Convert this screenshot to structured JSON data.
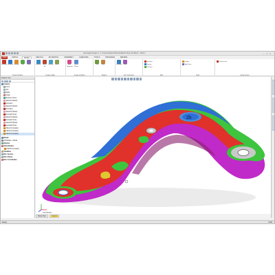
{
  "window": {
    "title": "Geomagic Design X - [ C:\\Users\\Admin\\Downloads\\01 Xbar.xdt (Mesh - Xbar) ]"
  },
  "ribbon_tabs": [
    {
      "label": "FILE"
    },
    {
      "label": "INITIAL"
    },
    {
      "label": "BASIC"
    },
    {
      "label": "SKETCH"
    },
    {
      "label": "3D SKETCH"
    },
    {
      "label": "ASSEMBLY"
    },
    {
      "label": "CHECKING"
    },
    {
      "label": "TOOLS"
    },
    {
      "label": "PROGRAM"
    },
    {
      "label": "REVIEW"
    }
  ],
  "ribbon_groups": [
    {
      "label": "Create Surface"
    },
    {
      "label": "Create & Edit"
    },
    {
      "label": "Create & Match"
    },
    {
      "label": "Region"
    },
    {
      "label": "Ref. Geometry"
    },
    {
      "label": "Edit"
    },
    {
      "label": "Tools"
    },
    {
      "label": "Assign Fixes"
    }
  ],
  "ribbon_buttons": [
    {
      "label": "Extrude"
    },
    {
      "label": "Revolve"
    },
    {
      "label": "Sweep"
    },
    {
      "label": "Loft"
    },
    {
      "label": "Offset"
    },
    {
      "label": "Extract"
    },
    {
      "label": "Mesh Fit"
    },
    {
      "label": "Surface"
    },
    {
      "label": "Mesh"
    },
    {
      "label": "Auto Segment"
    },
    {
      "label": "Insert Plane"
    },
    {
      "label": "Trim"
    },
    {
      "label": "Fillet"
    },
    {
      "label": "Chamfer"
    },
    {
      "label": "Shell"
    }
  ],
  "ribbon_small": [
    {
      "label": "Sections"
    },
    {
      "label": "Sweep"
    },
    {
      "label": "Fill Face"
    },
    {
      "label": "Untrim"
    },
    {
      "label": "Split Face"
    },
    {
      "label": "Delete Face"
    }
  ],
  "left_panel": {
    "title": "Feature Tree",
    "tree": [
      {
        "label": "Feature"
      },
      {
        "label": "Front"
      },
      {
        "label": "Top"
      },
      {
        "label": "Right"
      },
      {
        "label": "Origin"
      },
      {
        "label": "Boolean Union"
      },
      {
        "label": "Sketch1 (Mesh)"
      },
      {
        "label": "Extrude1"
      },
      {
        "label": "Sketch2 (Mesh)"
      },
      {
        "label": "Extrude2"
      },
      {
        "label": "Sketch3 (Mesh)"
      },
      {
        "label": "Extrude3 (Cut)"
      },
      {
        "label": "Sketch4 (Mesh)"
      },
      {
        "label": "Extrude4 (Cut)"
      },
      {
        "label": "Sketch5 (Mesh)"
      },
      {
        "label": "Extrude5 (Cut)"
      },
      {
        "label": "Fillet1 (Constant)"
      },
      {
        "label": "Fillet2 (Constant)"
      },
      {
        "label": "Fillet3 (Constant)"
      },
      {
        "label": "Model"
      },
      {
        "label": "3D Bodies - Model"
      },
      {
        "label": "Meshes"
      },
      {
        "label": "Solid Bodies"
      },
      {
        "label": "Fillet3 (Constant)"
      },
      {
        "label": "Variables"
      },
      {
        "label": "Ref. Vectors"
      },
      {
        "label": "Ref. Planes"
      },
      {
        "label": "Ref. Coordinates"
      }
    ]
  },
  "viewport": {
    "tabs": [
      {
        "label": "Model View"
      },
      {
        "label": "Analysis"
      }
    ],
    "triad_label": "Coordinates",
    "logo_text": "2k"
  },
  "status": {
    "left": "Ready",
    "right": "NUM"
  },
  "colors": {
    "file_tab": "#c0392b",
    "deviation_red": "#e0312b",
    "deviation_green": "#3ec43e",
    "deviation_blue": "#2f6fd6",
    "deviation_magenta": "#c02ac8"
  }
}
